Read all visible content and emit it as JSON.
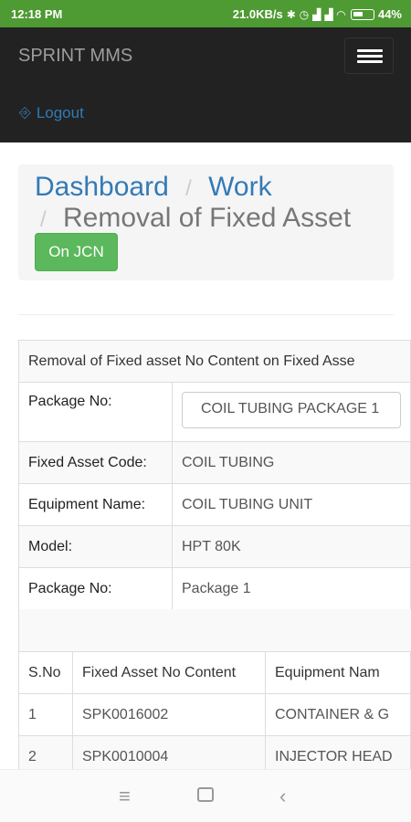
{
  "status_bar": {
    "time": "12:18 PM",
    "speed": "21.0KB/s",
    "battery": "44%"
  },
  "navbar": {
    "brand": "SPRINT MMS",
    "logout": "Logout"
  },
  "breadcrumb": {
    "dashboard": "Dashboard",
    "work": "Work",
    "separator": "/",
    "current": "Removal of Fixed Asset",
    "button": "On JCN"
  },
  "details": {
    "heading": "Removal of Fixed asset No Content on Fixed Asse",
    "rows": [
      {
        "label": "Package No:",
        "value": "COIL TUBING PACKAGE 1"
      },
      {
        "label": "Fixed Asset Code:",
        "value": "COIL TUBING"
      },
      {
        "label": "Equipment Name:",
        "value": "COIL TUBING UNIT"
      },
      {
        "label": "Model:",
        "value": "HPT 80K"
      },
      {
        "label": "Package No:",
        "value": "Package 1"
      }
    ]
  },
  "items_table": {
    "headers": [
      "S.No",
      "Fixed Asset No Content",
      "Equipment Nam"
    ],
    "rows": [
      [
        "1",
        "SPK0016002",
        "CONTAINER & G"
      ],
      [
        "2",
        "SPK0010004",
        "INJECTOR HEAD"
      ]
    ]
  },
  "colors": {
    "status_bar": "#4e9a33",
    "navbar": "#222222",
    "link": "#337ab7",
    "success_button": "#5cb85c"
  },
  "icons": {
    "logout": "sign-out-icon",
    "menu": "hamburger-icon"
  }
}
